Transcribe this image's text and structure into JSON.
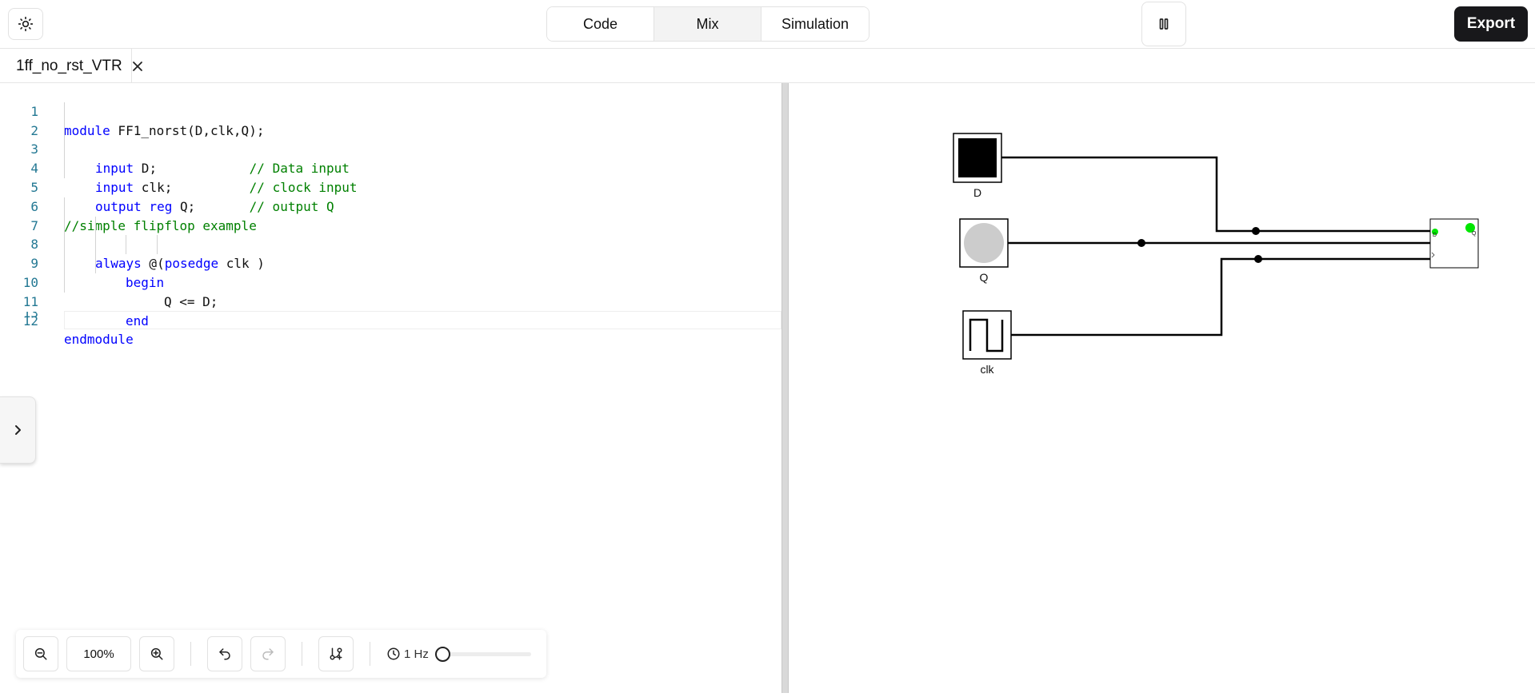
{
  "header": {
    "modes": [
      {
        "label": "Code",
        "active": false
      },
      {
        "label": "Mix",
        "active": true
      },
      {
        "label": "Simulation",
        "active": false
      }
    ],
    "export_label": "Export"
  },
  "tabs": [
    {
      "label": "1ff_no_rst_VTR"
    }
  ],
  "editor": {
    "lines": [
      {
        "n": "1"
      },
      {
        "n": "2"
      },
      {
        "n": "3"
      },
      {
        "n": "4"
      },
      {
        "n": "5"
      },
      {
        "n": "6"
      },
      {
        "n": "7"
      },
      {
        "n": "8"
      },
      {
        "n": "9"
      },
      {
        "n": "10"
      },
      {
        "n": "11"
      },
      {
        "n": "12"
      },
      {
        "n": "13"
      }
    ],
    "code": {
      "l1_kw": "module",
      "l1_rest": " FF1_norst(D,clk,Q);",
      "l2_kw": "input",
      "l2_rest": " D;            ",
      "l2_cm": "// Data input",
      "l3_kw": "input",
      "l3_rest": " clk;          ",
      "l3_cm": "// clock input",
      "l4_kw": "output reg",
      "l4_rest": " Q;       ",
      "l4_cm": "// output Q",
      "l6_cm": "//simple flipflop example",
      "l7_kw": "always",
      "l7_mid": " @(",
      "l7_kw2": "posedge",
      "l7_rest": " clk )",
      "l8_kw": "begin",
      "l9_rest": "Q <= D;",
      "l10_kw": "end",
      "l12_kw": "endmodule"
    }
  },
  "circuit": {
    "inputs": [
      {
        "label": "D",
        "state": "high"
      },
      {
        "label": "Q",
        "state": "low"
      },
      {
        "label": "clk",
        "state": "clock"
      }
    ],
    "colors": {
      "wire": "#000000",
      "active_port": "#00e600",
      "led_off": "#cccccc"
    }
  },
  "toolbar": {
    "zoom": "100%",
    "frequency": "1 Hz",
    "frequency_level": 0
  }
}
